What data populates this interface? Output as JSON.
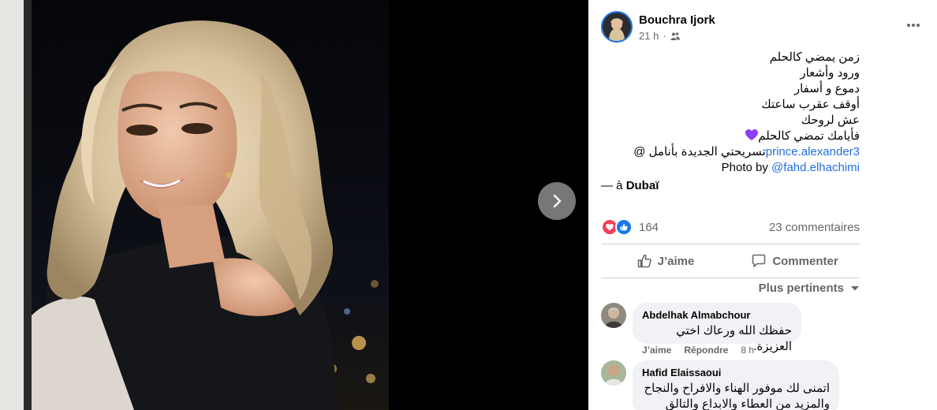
{
  "viewer": {
    "next_icon": "chevron-right-icon"
  },
  "post": {
    "author": "Bouchra Ijork",
    "time": "21 h",
    "audience_icon": "friends-icon",
    "more_icon": "more-horizontal-icon",
    "caption_lines": [
      "زمن يمضي كالحلم",
      "ورود وأشعار",
      "دموع و أسفار",
      "أوقف عقرب ساعتك",
      "عش لروحك",
      "فأيامك تمضي كالحلم"
    ],
    "heart_color": "#8a3ffc",
    "credit_prefix": "تسريحتي الجديدة بأنامل @",
    "credit_handle": "prince.alexander3",
    "photo_label": "Photo by ",
    "photo_handle": "@fahd.elhachimi",
    "location_prefix": "— à ",
    "location": "Dubaï"
  },
  "stats": {
    "reaction_count": "164",
    "comment_count": "23 commentaires"
  },
  "actions": {
    "like_label": "J’aime",
    "comment_label": "Commenter"
  },
  "sort": {
    "label": "Plus pertinents"
  },
  "comments": [
    {
      "name": "Abdelhak Almabchour",
      "text": "حفظك الله ورعاك اختي العزيزة.",
      "like": "J’aime",
      "reply": "Répondre",
      "time": "8 h"
    },
    {
      "name": "Hafid Elaissaoui",
      "text_lines": [
        "اتمنى لك موفور الهناء والافراح والنجاح",
        "والمزيد من العطاء والابداع والتالق"
      ]
    }
  ],
  "colors": {
    "link": "#216fdb",
    "like_blue": "#1877f2",
    "love_red": "#f33e58",
    "meta_gray": "#65676b"
  }
}
